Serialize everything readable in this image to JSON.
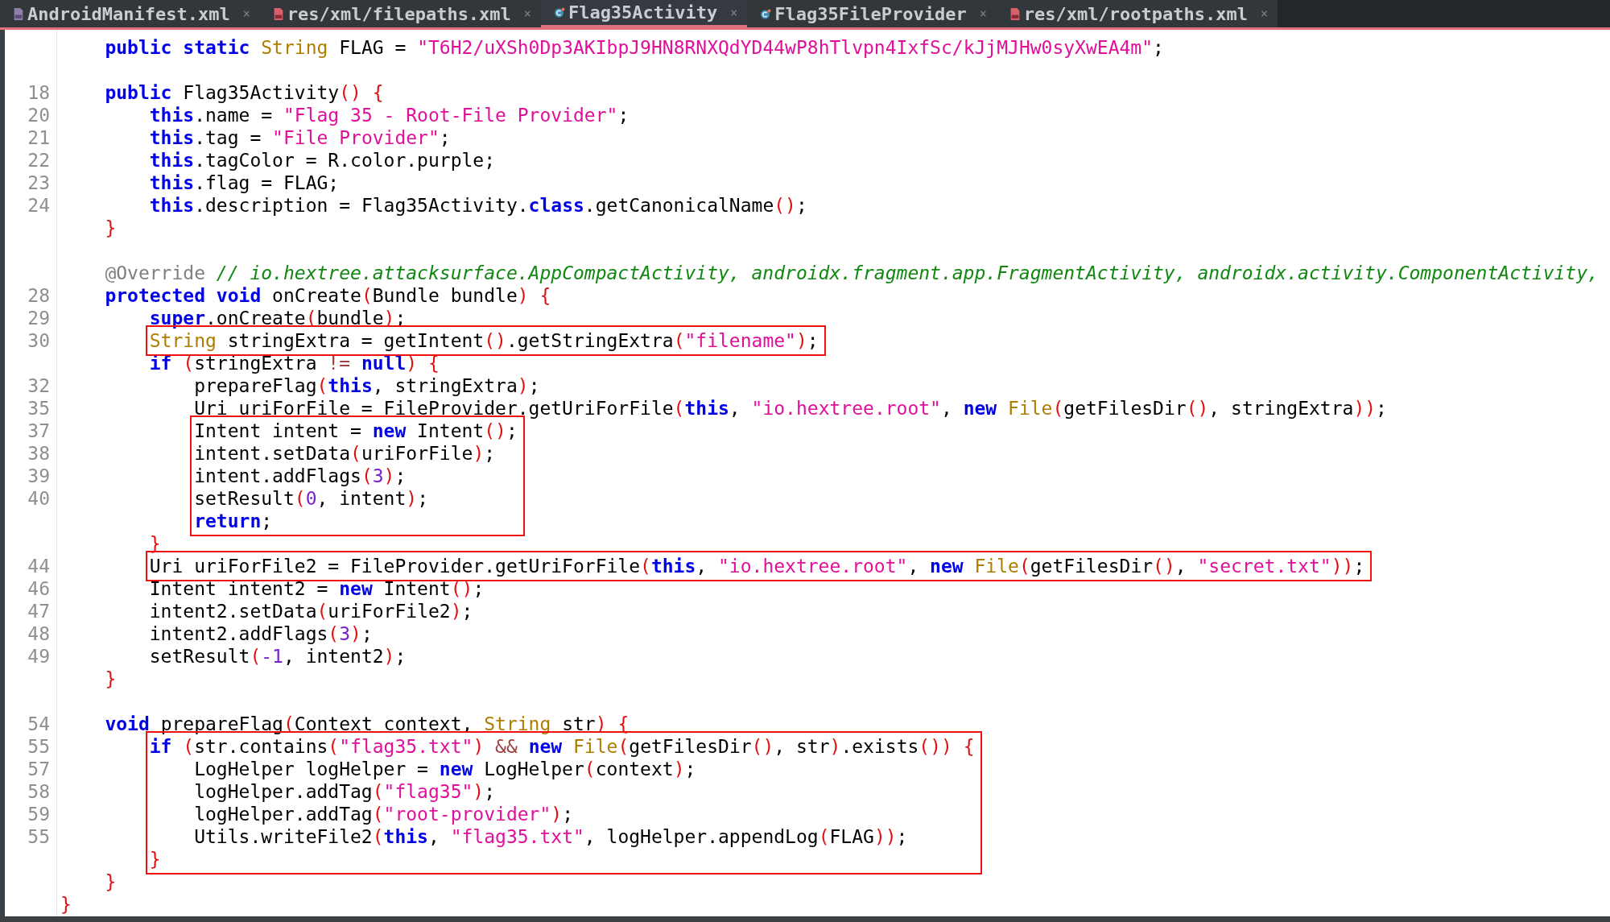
{
  "tabs": [
    {
      "label": "AndroidManifest.xml",
      "kind": "manifest",
      "close": "×",
      "selected": false
    },
    {
      "label": "res/xml/filepaths.xml",
      "kind": "xml",
      "close": "×",
      "selected": false
    },
    {
      "label": "Flag35Activity",
      "kind": "class",
      "close": "×",
      "selected": true
    },
    {
      "label": "Flag35FileProvider",
      "kind": "class",
      "close": "×",
      "selected": false
    },
    {
      "label": "res/xml/rootpaths.xml",
      "kind": "xml",
      "close": "×",
      "selected": false
    }
  ],
  "code": [
    {
      "kind": "line",
      "tokens": [
        {
          "kind": "k",
          "text": "    public"
        },
        {
          "kind": "k",
          "text": " static"
        },
        {
          "kind": "t",
          "text": " String"
        },
        {
          "kind": "p",
          "text": " FLAG = "
        },
        {
          "kind": "s",
          "text": "\"T6H2/uXSh0Dp3AKIbpJ9HN8RNXQdYD44wP8hTlvpn4IxfSc/kJjMJHw0syXwEA4m\""
        },
        {
          "kind": "p",
          "text": ";"
        }
      ]
    },
    {
      "kind": "blank"
    },
    {
      "kind": "line",
      "number": "18",
      "tokens": [
        {
          "kind": "k",
          "text": "    public"
        },
        {
          "kind": "p",
          "text": " Flag35Activity"
        },
        {
          "kind": "r",
          "text": "()"
        },
        {
          "kind": "r",
          "text": " {"
        }
      ]
    },
    {
      "kind": "line",
      "number": "20",
      "tokens": [
        {
          "kind": "k",
          "text": "        this"
        },
        {
          "kind": "p",
          "text": ".name = "
        },
        {
          "kind": "s",
          "text": "\"Flag 35 - Root-File Provider\""
        },
        {
          "kind": "p",
          "text": ";"
        }
      ]
    },
    {
      "kind": "line",
      "number": "21",
      "tokens": [
        {
          "kind": "k",
          "text": "        this"
        },
        {
          "kind": "p",
          "text": ".tag = "
        },
        {
          "kind": "s",
          "text": "\"File Provider\""
        },
        {
          "kind": "p",
          "text": ";"
        }
      ]
    },
    {
      "kind": "line",
      "number": "22",
      "tokens": [
        {
          "kind": "k",
          "text": "        this"
        },
        {
          "kind": "p",
          "text": ".tagColor = R.color.purple;"
        }
      ]
    },
    {
      "kind": "line",
      "number": "23",
      "tokens": [
        {
          "kind": "k",
          "text": "        this"
        },
        {
          "kind": "p",
          "text": ".flag = FLAG;"
        }
      ]
    },
    {
      "kind": "line",
      "number": "24",
      "tokens": [
        {
          "kind": "k",
          "text": "        this"
        },
        {
          "kind": "p",
          "text": ".description = Flag35Activity."
        },
        {
          "kind": "k",
          "text": "class"
        },
        {
          "kind": "p",
          "text": ".getCanonicalName"
        },
        {
          "kind": "r",
          "text": "()"
        },
        {
          "kind": "p",
          "text": ";"
        }
      ]
    },
    {
      "kind": "line",
      "tokens": [
        {
          "kind": "r",
          "text": "    }"
        }
      ]
    },
    {
      "kind": "blank"
    },
    {
      "kind": "line",
      "tokens": [
        {
          "kind": "a",
          "text": "    @Override"
        },
        {
          "kind": "c",
          "text": " // io.hextree.attacksurface.AppCompactActivity, androidx.fragment.app.FragmentActivity, androidx.activity.ComponentActivity,"
        }
      ]
    },
    {
      "kind": "line",
      "number": "28",
      "tokens": [
        {
          "kind": "k",
          "text": "    protected"
        },
        {
          "kind": "k",
          "text": " void"
        },
        {
          "kind": "p",
          "text": " onCreate"
        },
        {
          "kind": "r",
          "text": "("
        },
        {
          "kind": "p",
          "text": "Bundle bundle"
        },
        {
          "kind": "r",
          "text": ")"
        },
        {
          "kind": "r",
          "text": " {"
        }
      ]
    },
    {
      "kind": "line",
      "number": "29",
      "tokens": [
        {
          "kind": "k",
          "text": "        super"
        },
        {
          "kind": "p",
          "text": ".onCreate"
        },
        {
          "kind": "r",
          "text": "("
        },
        {
          "kind": "p",
          "text": "bundle"
        },
        {
          "kind": "r",
          "text": ")"
        },
        {
          "kind": "p",
          "text": ";"
        }
      ]
    },
    {
      "kind": "box",
      "lines": [
        {
          "kind": "line",
          "number": "30",
          "tokens": [
            {
              "kind": "t",
              "text": "        String"
            },
            {
              "kind": "p",
              "text": " stringExtra = getIntent"
            },
            {
              "kind": "r",
              "text": "()"
            },
            {
              "kind": "p",
              "text": ".getStringExtra"
            },
            {
              "kind": "r",
              "text": "("
            },
            {
              "kind": "s",
              "text": "\"filename\""
            },
            {
              "kind": "r",
              "text": ")"
            },
            {
              "kind": "p",
              "text": ";"
            }
          ]
        }
      ]
    },
    {
      "kind": "line",
      "tokens": [
        {
          "kind": "k",
          "text": "        if"
        },
        {
          "kind": "r",
          "text": " ("
        },
        {
          "kind": "p",
          "text": "stringExtra "
        },
        {
          "kind": "o",
          "text": "!="
        },
        {
          "kind": "k",
          "text": " null"
        },
        {
          "kind": "r",
          "text": ")"
        },
        {
          "kind": "r",
          "text": " {"
        }
      ]
    },
    {
      "kind": "line",
      "number": "32",
      "tokens": [
        {
          "kind": "p",
          "text": "            prepareFlag"
        },
        {
          "kind": "r",
          "text": "("
        },
        {
          "kind": "k",
          "text": "this"
        },
        {
          "kind": "p",
          "text": ", stringExtra"
        },
        {
          "kind": "r",
          "text": ")"
        },
        {
          "kind": "p",
          "text": ";"
        }
      ]
    },
    {
      "kind": "line",
      "number": "35",
      "tokens": [
        {
          "kind": "p",
          "text": "            Uri uriForFile = FileProvider.getUriForFile"
        },
        {
          "kind": "r",
          "text": "("
        },
        {
          "kind": "k",
          "text": "this"
        },
        {
          "kind": "p",
          "text": ", "
        },
        {
          "kind": "s",
          "text": "\"io.hextree.root\""
        },
        {
          "kind": "p",
          "text": ", "
        },
        {
          "kind": "k",
          "text": "new"
        },
        {
          "kind": "t",
          "text": " File"
        },
        {
          "kind": "r",
          "text": "("
        },
        {
          "kind": "p",
          "text": "getFilesDir"
        },
        {
          "kind": "r",
          "text": "()"
        },
        {
          "kind": "p",
          "text": ", stringExtra"
        },
        {
          "kind": "r",
          "text": "))"
        },
        {
          "kind": "p",
          "text": ";"
        }
      ]
    },
    {
      "kind": "box",
      "lines": [
        {
          "kind": "line",
          "number": "37",
          "tokens": [
            {
              "kind": "p",
              "text": "            Intent intent = "
            },
            {
              "kind": "k",
              "text": "new"
            },
            {
              "kind": "p",
              "text": " Intent"
            },
            {
              "kind": "r",
              "text": "()"
            },
            {
              "kind": "p",
              "text": ";"
            }
          ]
        },
        {
          "kind": "line",
          "number": "38",
          "tokens": [
            {
              "kind": "p",
              "text": "            intent.setData"
            },
            {
              "kind": "r",
              "text": "("
            },
            {
              "kind": "p",
              "text": "uriForFile"
            },
            {
              "kind": "r",
              "text": ")"
            },
            {
              "kind": "p",
              "text": ";"
            }
          ]
        },
        {
          "kind": "line",
          "number": "39",
          "tokens": [
            {
              "kind": "p",
              "text": "            intent.addFlags"
            },
            {
              "kind": "r",
              "text": "("
            },
            {
              "kind": "n",
              "text": "3"
            },
            {
              "kind": "r",
              "text": ")"
            },
            {
              "kind": "p",
              "text": ";"
            }
          ]
        },
        {
          "kind": "line",
          "number": "40",
          "tokens": [
            {
              "kind": "p",
              "text": "            setResult"
            },
            {
              "kind": "r",
              "text": "("
            },
            {
              "kind": "n",
              "text": "0"
            },
            {
              "kind": "p",
              "text": ", intent"
            },
            {
              "kind": "r",
              "text": ")"
            },
            {
              "kind": "p",
              "text": ";"
            }
          ]
        },
        {
          "kind": "line",
          "tokens": [
            {
              "kind": "k",
              "text": "            return"
            },
            {
              "kind": "p",
              "text": ";"
            }
          ]
        }
      ]
    },
    {
      "kind": "line",
      "tokens": [
        {
          "kind": "r",
          "text": "        }"
        }
      ]
    },
    {
      "kind": "box",
      "lines": [
        {
          "kind": "line",
          "number": "44",
          "tokens": [
            {
              "kind": "p",
              "text": "        Uri uriForFile2 = FileProvider.getUriForFile"
            },
            {
              "kind": "r",
              "text": "("
            },
            {
              "kind": "k",
              "text": "this"
            },
            {
              "kind": "p",
              "text": ", "
            },
            {
              "kind": "s",
              "text": "\"io.hextree.root\""
            },
            {
              "kind": "p",
              "text": ", "
            },
            {
              "kind": "k",
              "text": "new"
            },
            {
              "kind": "t",
              "text": " File"
            },
            {
              "kind": "r",
              "text": "("
            },
            {
              "kind": "p",
              "text": "getFilesDir"
            },
            {
              "kind": "r",
              "text": "()"
            },
            {
              "kind": "p",
              "text": ", "
            },
            {
              "kind": "s",
              "text": "\"secret.txt\""
            },
            {
              "kind": "r",
              "text": "))"
            },
            {
              "kind": "p",
              "text": ";"
            }
          ]
        }
      ]
    },
    {
      "kind": "line",
      "number": "46",
      "tokens": [
        {
          "kind": "p",
          "text": "        Intent intent2 = "
        },
        {
          "kind": "k",
          "text": "new"
        },
        {
          "kind": "p",
          "text": " Intent"
        },
        {
          "kind": "r",
          "text": "()"
        },
        {
          "kind": "p",
          "text": ";"
        }
      ]
    },
    {
      "kind": "line",
      "number": "47",
      "tokens": [
        {
          "kind": "p",
          "text": "        intent2.setData"
        },
        {
          "kind": "r",
          "text": "("
        },
        {
          "kind": "p",
          "text": "uriForFile2"
        },
        {
          "kind": "r",
          "text": ")"
        },
        {
          "kind": "p",
          "text": ";"
        }
      ]
    },
    {
      "kind": "line",
      "number": "48",
      "tokens": [
        {
          "kind": "p",
          "text": "        intent2.addFlags"
        },
        {
          "kind": "r",
          "text": "("
        },
        {
          "kind": "n",
          "text": "3"
        },
        {
          "kind": "r",
          "text": ")"
        },
        {
          "kind": "p",
          "text": ";"
        }
      ]
    },
    {
      "kind": "line",
      "number": "49",
      "tokens": [
        {
          "kind": "p",
          "text": "        setResult"
        },
        {
          "kind": "r",
          "text": "("
        },
        {
          "kind": "n",
          "text": "-1"
        },
        {
          "kind": "p",
          "text": ", intent2"
        },
        {
          "kind": "r",
          "text": ")"
        },
        {
          "kind": "p",
          "text": ";"
        }
      ]
    },
    {
      "kind": "line",
      "tokens": [
        {
          "kind": "r",
          "text": "    }"
        }
      ]
    },
    {
      "kind": "blank"
    },
    {
      "kind": "line",
      "number": "54",
      "tokens": [
        {
          "kind": "k",
          "text": "    void"
        },
        {
          "kind": "p",
          "text": " prepareFlag"
        },
        {
          "kind": "r",
          "text": "("
        },
        {
          "kind": "p",
          "text": "Context context, "
        },
        {
          "kind": "t",
          "text": "String"
        },
        {
          "kind": "p",
          "text": " str"
        },
        {
          "kind": "r",
          "text": ")"
        },
        {
          "kind": "r",
          "text": " {"
        }
      ]
    },
    {
      "kind": "box",
      "lines": [
        {
          "kind": "line",
          "number": "55",
          "tokens": [
            {
              "kind": "k",
              "text": "        if"
            },
            {
              "kind": "r",
              "text": " ("
            },
            {
              "kind": "p",
              "text": "str.contains"
            },
            {
              "kind": "r",
              "text": "("
            },
            {
              "kind": "s",
              "text": "\"flag35.txt\""
            },
            {
              "kind": "r",
              "text": ")"
            },
            {
              "kind": "o",
              "text": " &&"
            },
            {
              "kind": "k",
              "text": " new"
            },
            {
              "kind": "t",
              "text": " File"
            },
            {
              "kind": "r",
              "text": "("
            },
            {
              "kind": "p",
              "text": "getFilesDir"
            },
            {
              "kind": "r",
              "text": "()"
            },
            {
              "kind": "p",
              "text": ", str"
            },
            {
              "kind": "r",
              "text": ")"
            },
            {
              "kind": "p",
              "text": ".exists"
            },
            {
              "kind": "r",
              "text": "())"
            },
            {
              "kind": "r",
              "text": " {"
            }
          ]
        },
        {
          "kind": "line",
          "number": "57",
          "tokens": [
            {
              "kind": "p",
              "text": "            LogHelper logHelper = "
            },
            {
              "kind": "k",
              "text": "new"
            },
            {
              "kind": "p",
              "text": " LogHelper"
            },
            {
              "kind": "r",
              "text": "("
            },
            {
              "kind": "p",
              "text": "context"
            },
            {
              "kind": "r",
              "text": ")"
            },
            {
              "kind": "p",
              "text": ";"
            }
          ]
        },
        {
          "kind": "line",
          "number": "58",
          "tokens": [
            {
              "kind": "p",
              "text": "            logHelper.addTag"
            },
            {
              "kind": "r",
              "text": "("
            },
            {
              "kind": "s",
              "text": "\"flag35\""
            },
            {
              "kind": "r",
              "text": ")"
            },
            {
              "kind": "p",
              "text": ";"
            }
          ]
        },
        {
          "kind": "line",
          "number": "59",
          "tokens": [
            {
              "kind": "p",
              "text": "            logHelper.addTag"
            },
            {
              "kind": "r",
              "text": "("
            },
            {
              "kind": "s",
              "text": "\"root-provider\""
            },
            {
              "kind": "r",
              "text": ")"
            },
            {
              "kind": "p",
              "text": ";"
            }
          ]
        },
        {
          "kind": "line",
          "number": "55",
          "tokens": [
            {
              "kind": "p",
              "text": "            Utils.writeFile2"
            },
            {
              "kind": "r",
              "text": "("
            },
            {
              "kind": "k",
              "text": "this"
            },
            {
              "kind": "p",
              "text": ", "
            },
            {
              "kind": "s",
              "text": "\"flag35.txt\""
            },
            {
              "kind": "p",
              "text": ", logHelper.appendLog"
            },
            {
              "kind": "r",
              "text": "("
            },
            {
              "kind": "p",
              "text": "FLAG"
            },
            {
              "kind": "r",
              "text": "))"
            },
            {
              "kind": "p",
              "text": ";"
            }
          ]
        },
        {
          "kind": "line",
          "tokens": [
            {
              "kind": "r",
              "text": "        }"
            }
          ]
        }
      ]
    },
    {
      "kind": "line",
      "tokens": [
        {
          "kind": "r",
          "text": "    }"
        }
      ]
    },
    {
      "kind": "line",
      "tokens": [
        {
          "kind": "r",
          "text": "}"
        }
      ]
    }
  ]
}
